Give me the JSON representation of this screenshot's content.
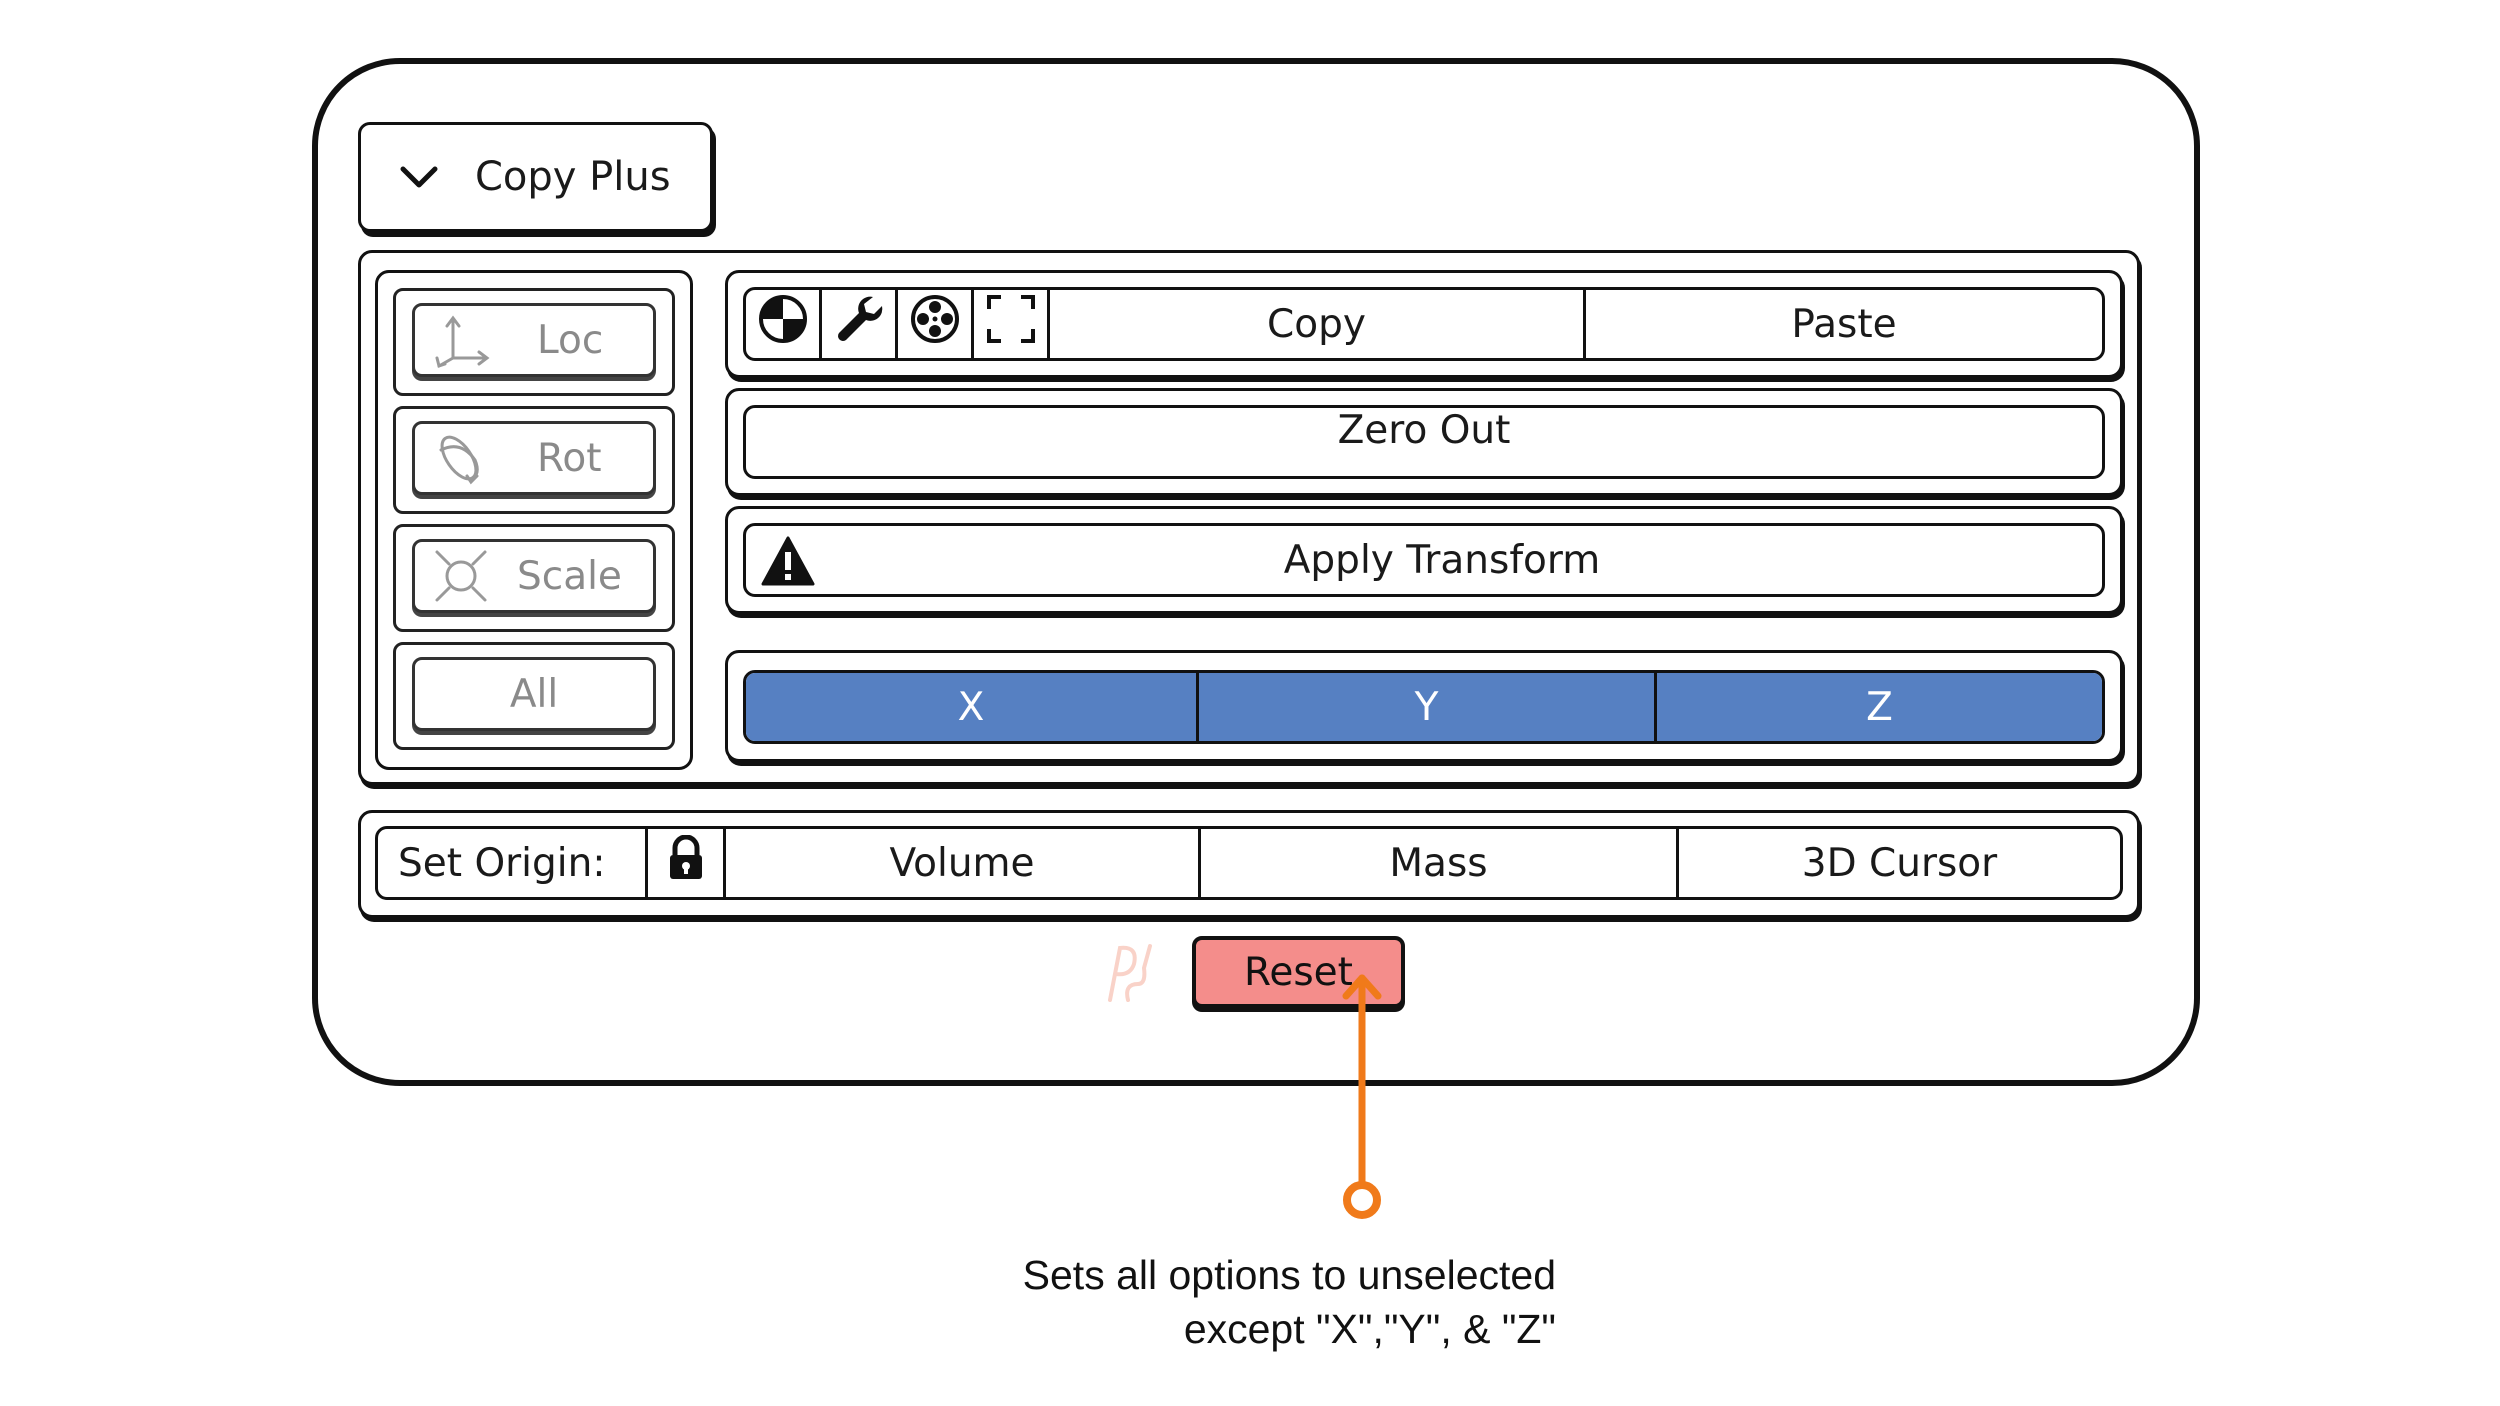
{
  "panel": {
    "header_label": "Copy Plus",
    "header_icon": "chevron-down-icon"
  },
  "toggles": [
    {
      "label": "Loc",
      "icon": "location-axes-icon",
      "enabled": false
    },
    {
      "label": "Rot",
      "icon": "rotation-icon",
      "enabled": false
    },
    {
      "label": "Scale",
      "icon": "scale-icon",
      "enabled": false
    },
    {
      "label": "All",
      "enabled": false
    }
  ],
  "toolbar": {
    "icons": [
      "shading-sphere-icon",
      "wrench-icon",
      "film-reel-icon",
      "frame-brackets-icon"
    ],
    "copy_label": "Copy",
    "paste_label": "Paste"
  },
  "zero_out_label": "Zero Out",
  "apply_transform": {
    "label": "Apply Transform",
    "icon": "warning-triangle-icon"
  },
  "axes": {
    "labels": [
      "X",
      "Y",
      "Z"
    ],
    "selected_color": "#5680c2"
  },
  "set_origin": {
    "label": "Set Origin:",
    "lock_icon": "lock-icon",
    "options": [
      "Volume",
      "Mass",
      "3D Cursor"
    ]
  },
  "reset": {
    "label": "Reset",
    "color": "#f48d8b"
  },
  "annotation": {
    "line1": "Sets all options to unselected",
    "line2": "except \"X\",\"Y\", & \"Z\"",
    "color": "#f07a1a"
  }
}
